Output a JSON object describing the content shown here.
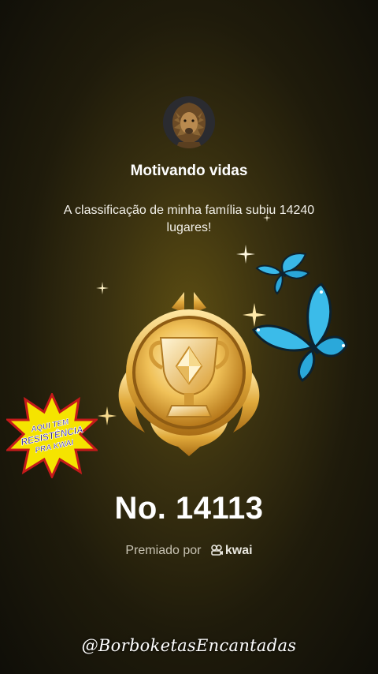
{
  "profile": {
    "name": "Motivando vidas",
    "avatar_icon": "lion-avatar-icon"
  },
  "message": {
    "text": "A classificação de minha família subiu 14240 lugares!"
  },
  "badge": {
    "icon": "gold-trophy-badge-icon"
  },
  "sticker": {
    "line1": "AQUI TEM",
    "line2": "RESISTÊNCIA",
    "line3": "PRA KWAI",
    "color": "#f5e400"
  },
  "rank": {
    "text": "No. 14113"
  },
  "awarded": {
    "label": "Premiado por",
    "brand": "kwai"
  },
  "watermark": {
    "text": "@BorboketasEncantadas"
  },
  "colors": {
    "gold": "#e0a93a",
    "butterfly": "#39b8e8",
    "background": "#3b3210"
  }
}
